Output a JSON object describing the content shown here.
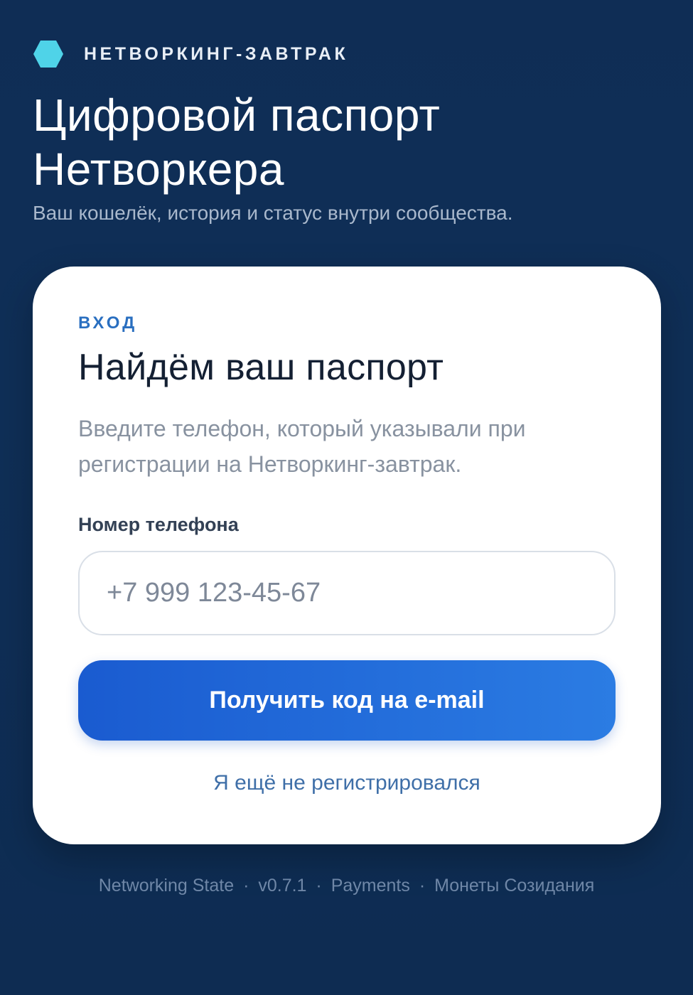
{
  "brand": {
    "name": "НЕТВОРКИНГ-ЗАВТРАК",
    "icon": "hexagon-logo-icon",
    "icon_color": "#4fd3e8"
  },
  "hero": {
    "title_line1": "Цифровой паспорт",
    "title_line2": "Нетворкера",
    "subtitle": "Ваш кошелёк, история и статус внутри сообщества."
  },
  "card": {
    "eyebrow": "ВХОД",
    "title": "Найдём ваш паспорт",
    "description": "Введите телефон, который указывали при регистрации на Нетворкинг-завтрак.",
    "phone": {
      "label": "Номер телефона",
      "value": "",
      "placeholder": "+7 999 123-45-67"
    },
    "submit_label": "Получить код на e-mail",
    "register_link": "Я ещё не регистрировался"
  },
  "footer": {
    "items": [
      "Networking State",
      "v0.7.1",
      "Payments",
      "Монеты Созидания"
    ],
    "separator": "·"
  },
  "colors": {
    "background": "#0f2d55",
    "accent": "#2a6fc0",
    "button_start": "#1a5bd0",
    "button_end": "#2b7ce3",
    "logo": "#4fd3e8"
  }
}
